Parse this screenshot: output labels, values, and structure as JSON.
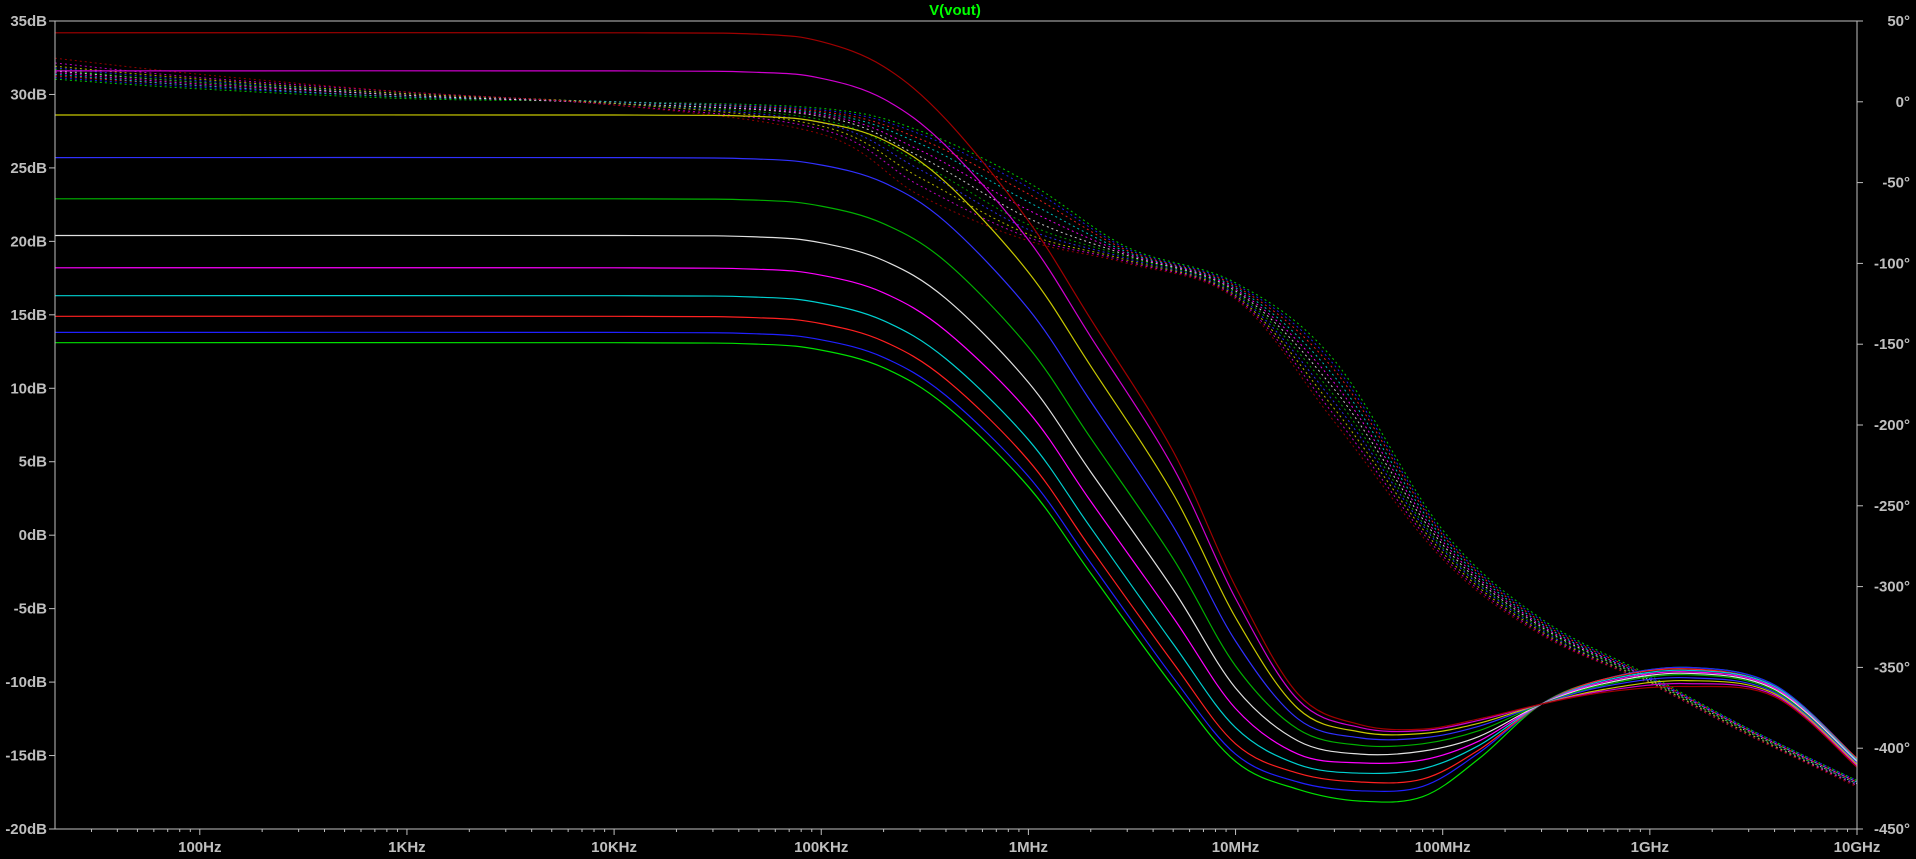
{
  "chart_data": {
    "type": "line",
    "title": "V(vout)",
    "title_color": "#00ff00",
    "background": "#000000",
    "axis_color": "#bfbfbf",
    "grid": false,
    "x_scale": "log",
    "x_unit": "Hz",
    "xlim_hz": [
      20,
      10000000000
    ],
    "x_ticks": [
      {
        "value": 100,
        "label": "100Hz"
      },
      {
        "value": 1000,
        "label": "1KHz"
      },
      {
        "value": 10000,
        "label": "10KHz"
      },
      {
        "value": 100000,
        "label": "100KHz"
      },
      {
        "value": 1000000,
        "label": "1MHz"
      },
      {
        "value": 10000000,
        "label": "10MHz"
      },
      {
        "value": 100000000,
        "label": "100MHz"
      },
      {
        "value": 1000000000,
        "label": "1GHz"
      },
      {
        "value": 10000000000,
        "label": "10GHz"
      }
    ],
    "ylim_left_db": [
      -20,
      35
    ],
    "y_left_ticks": [
      {
        "value": 35,
        "label": "35dB"
      },
      {
        "value": 30,
        "label": "30dB"
      },
      {
        "value": 25,
        "label": "25dB"
      },
      {
        "value": 20,
        "label": "20dB"
      },
      {
        "value": 15,
        "label": "15dB"
      },
      {
        "value": 10,
        "label": "10dB"
      },
      {
        "value": 5,
        "label": "5dB"
      },
      {
        "value": 0,
        "label": "0dB"
      },
      {
        "value": -5,
        "label": "-5dB"
      },
      {
        "value": -10,
        "label": "-10dB"
      },
      {
        "value": -15,
        "label": "-15dB"
      },
      {
        "value": -20,
        "label": "-20dB"
      }
    ],
    "ylim_right_deg": [
      -450,
      50
    ],
    "y_right_ticks": [
      {
        "value": 50,
        "label": "50°"
      },
      {
        "value": 0,
        "label": "0°"
      },
      {
        "value": -50,
        "label": "-50°"
      },
      {
        "value": -100,
        "label": "-100°"
      },
      {
        "value": -150,
        "label": "-150°"
      },
      {
        "value": -200,
        "label": "-200°"
      },
      {
        "value": -250,
        "label": "-250°"
      },
      {
        "value": -300,
        "label": "-300°"
      },
      {
        "value": -350,
        "label": "-350°"
      },
      {
        "value": -400,
        "label": "-400°"
      },
      {
        "value": -450,
        "label": "-450°"
      }
    ],
    "magnitude_x_hz": [
      20,
      10000,
      50000,
      100000,
      200000,
      400000,
      1000000,
      2000000,
      5000000,
      10000000,
      20000000,
      40000000,
      80000000,
      150000000,
      300000000,
      600000000,
      1500000000,
      4000000000,
      10000000000
    ],
    "magnitude_series": [
      {
        "color": "#00e000",
        "values_db": [
          13.1,
          13.1,
          13.0,
          12.6,
          11.4,
          8.8,
          3.3,
          -2.6,
          -10.3,
          -15.4,
          -17.3,
          -18.1,
          -17.8,
          -15.2,
          -11.5,
          -9.8,
          -9.0,
          -10.2,
          -15.2
        ]
      },
      {
        "color": "#2020ff",
        "values_db": [
          13.8,
          13.8,
          13.7,
          13.3,
          12.1,
          9.5,
          4.0,
          -1.9,
          -9.7,
          -14.9,
          -16.8,
          -17.4,
          -17.1,
          -14.8,
          -11.5,
          -9.8,
          -9.0,
          -10.2,
          -15.2
        ]
      },
      {
        "color": "#ff2020",
        "values_db": [
          14.9,
          14.9,
          14.8,
          14.4,
          13.2,
          10.6,
          5.1,
          -0.9,
          -8.7,
          -14.2,
          -16.2,
          -16.8,
          -16.6,
          -14.6,
          -11.5,
          -9.8,
          -9.1,
          -10.3,
          -15.2
        ]
      },
      {
        "color": "#00d0d0",
        "values_db": [
          16.3,
          16.3,
          16.2,
          15.8,
          14.6,
          12.0,
          6.5,
          0.5,
          -7.4,
          -13.1,
          -15.6,
          -16.2,
          -15.9,
          -14.3,
          -11.5,
          -9.9,
          -9.2,
          -10.3,
          -15.3
        ]
      },
      {
        "color": "#ff00ff",
        "values_db": [
          18.2,
          18.2,
          18.1,
          17.7,
          16.5,
          13.9,
          8.4,
          2.3,
          -5.6,
          -11.8,
          -14.9,
          -15.5,
          -15.3,
          -14.0,
          -11.5,
          -10.0,
          -9.3,
          -10.4,
          -15.4
        ]
      },
      {
        "color": "#e0e0e0",
        "values_db": [
          20.4,
          20.4,
          20.3,
          19.9,
          18.7,
          16.1,
          10.4,
          4.3,
          -3.7,
          -10.4,
          -14.0,
          -14.9,
          -14.7,
          -13.7,
          -11.5,
          -10.1,
          -9.4,
          -10.5,
          -15.4
        ]
      },
      {
        "color": "#00b000",
        "values_db": [
          22.9,
          22.9,
          22.8,
          22.4,
          21.2,
          18.6,
          12.8,
          6.6,
          -1.6,
          -8.9,
          -13.2,
          -14.3,
          -14.2,
          -13.3,
          -11.5,
          -10.2,
          -9.5,
          -10.6,
          -15.5
        ]
      },
      {
        "color": "#3030ff",
        "values_db": [
          25.7,
          25.7,
          25.6,
          25.2,
          24.0,
          21.3,
          15.4,
          9.1,
          0.6,
          -7.2,
          -12.5,
          -13.8,
          -13.8,
          -13.0,
          -11.5,
          -10.3,
          -9.7,
          -10.7,
          -15.5
        ]
      },
      {
        "color": "#c8c800",
        "values_db": [
          28.6,
          28.6,
          28.5,
          28.1,
          26.9,
          24.0,
          17.9,
          11.5,
          2.8,
          -5.6,
          -11.8,
          -13.4,
          -13.5,
          -12.8,
          -11.5,
          -10.5,
          -9.9,
          -10.8,
          -15.6
        ]
      },
      {
        "color": "#d000d0",
        "values_db": [
          31.6,
          31.6,
          31.5,
          31.1,
          29.7,
          26.5,
          20.1,
          13.5,
          4.6,
          -4.3,
          -11.2,
          -13.1,
          -13.3,
          -12.6,
          -11.5,
          -10.6,
          -10.1,
          -10.9,
          -15.7
        ]
      },
      {
        "color": "#a00000",
        "values_db": [
          34.2,
          34.2,
          34.1,
          33.6,
          31.9,
          28.3,
          21.4,
          14.7,
          5.7,
          -3.5,
          -10.8,
          -12.9,
          -13.2,
          -12.5,
          -11.5,
          -10.7,
          -10.3,
          -11.0,
          -15.8
        ]
      }
    ],
    "phase_x_hz": [
      20,
      100,
      1000,
      10000,
      100000,
      300000,
      1000000,
      3000000,
      10000000,
      30000000,
      100000000,
      300000000,
      1000000000,
      3000000000,
      10000000000
    ],
    "phase_series": [
      {
        "color": "#00e000",
        "values_deg": [
          14,
          8,
          2,
          0,
          -4,
          -18,
          -50,
          -90,
          -112,
          -160,
          -265,
          -320,
          -355,
          -388,
          -420
        ]
      },
      {
        "color": "#2020ff",
        "values_deg": [
          15,
          9,
          3,
          0,
          -5,
          -20,
          -53,
          -91,
          -113,
          -163,
          -267,
          -321,
          -356,
          -388,
          -420
        ]
      },
      {
        "color": "#ff2020",
        "values_deg": [
          16,
          10,
          3,
          0,
          -6,
          -23,
          -57,
          -92,
          -114,
          -166,
          -268,
          -322,
          -356,
          -389,
          -421
        ]
      },
      {
        "color": "#00d0d0",
        "values_deg": [
          17,
          10,
          3,
          0,
          -7,
          -26,
          -62,
          -93,
          -115,
          -170,
          -270,
          -323,
          -357,
          -389,
          -421
        ]
      },
      {
        "color": "#ff00ff",
        "values_deg": [
          18,
          11,
          4,
          -1,
          -8,
          -30,
          -67,
          -94,
          -116,
          -174,
          -272,
          -324,
          -357,
          -389,
          -421
        ]
      },
      {
        "color": "#e0e0e0",
        "values_deg": [
          19,
          12,
          4,
          -1,
          -9,
          -34,
          -72,
          -95,
          -117,
          -178,
          -274,
          -325,
          -358,
          -390,
          -422
        ]
      },
      {
        "color": "#00b000",
        "values_deg": [
          20,
          12,
          5,
          -1,
          -11,
          -38,
          -76,
          -96,
          -118,
          -182,
          -276,
          -326,
          -358,
          -390,
          -422
        ]
      },
      {
        "color": "#3030ff",
        "values_deg": [
          21,
          13,
          5,
          -1,
          -13,
          -42,
          -79,
          -97,
          -119,
          -186,
          -277,
          -327,
          -359,
          -391,
          -422
        ]
      },
      {
        "color": "#c8c800",
        "values_deg": [
          22,
          14,
          5,
          -1,
          -15,
          -47,
          -82,
          -98,
          -120,
          -190,
          -279,
          -328,
          -359,
          -391,
          -423
        ]
      },
      {
        "color": "#d000d0",
        "values_deg": [
          24,
          15,
          6,
          -2,
          -17,
          -52,
          -84,
          -99,
          -121,
          -194,
          -281,
          -329,
          -360,
          -392,
          -423
        ]
      },
      {
        "color": "#a00000",
        "values_deg": [
          27,
          17,
          6,
          -2,
          -20,
          -58,
          -86,
          -100,
          -122,
          -198,
          -283,
          -330,
          -360,
          -392,
          -424
        ]
      }
    ]
  }
}
